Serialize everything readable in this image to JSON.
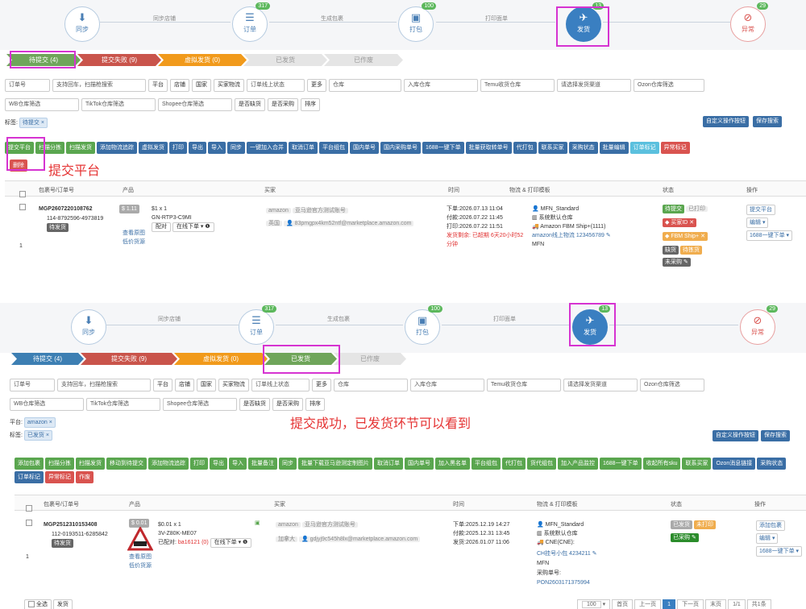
{
  "top": {
    "steps": [
      {
        "label": "同步"
      },
      {
        "label": "订单",
        "badge": "317"
      },
      {
        "label": "打包",
        "badge": "100"
      },
      {
        "label": "发货",
        "badge": "13"
      },
      {
        "label": "异常",
        "badge": "29"
      }
    ],
    "connectors": [
      "同步店铺",
      "生成包裹",
      "打印面单"
    ],
    "pipeline": [
      "待提交 (4)",
      "提交失败 (9)",
      "虚拟发货 (0)",
      "已发货",
      "已作废"
    ],
    "filters_row1": [
      "订单号",
      "支持回车，扫描枪搜索",
      "平台",
      "店铺",
      "国家",
      "买家物流",
      "订单线上状态",
      "更多",
      "仓库",
      "入库仓库",
      "Temu收货仓库",
      "请选择发货渠道",
      "Ozon仓库筛选"
    ],
    "filters_row2": [
      "WB仓库筛选",
      "TikTok仓库筛选",
      "Shopee仓库筛选",
      "是否缺货",
      "是否采购",
      "排序"
    ],
    "tag_label": "标签:",
    "tag_value": "待提交",
    "right_buttons": [
      "自定义操作按钮",
      "保存搜索"
    ],
    "actions": [
      "提交平台",
      "扫描分拣",
      "扫描发货",
      "添加物流追踪",
      "虚拟发货",
      "打印",
      "导出",
      "导入",
      "同步",
      "一键加入合并",
      "取消订单",
      "平台组包",
      "国内单号",
      "国内采购单号",
      "1688一键下单",
      "批量获取转单号",
      "代打包",
      "联系买家",
      "采购状态",
      "批量编辑",
      "订单标记",
      "异常标记",
      "删除"
    ],
    "annotation": "提交平台",
    "table_headers": [
      "包裹号/订单号",
      "产品",
      "买家",
      "时间",
      "物流 & 打印模板",
      "状态",
      "操作"
    ],
    "row": {
      "index": "1",
      "package_no": "MGP2607220108762",
      "order_no": "114-8792596-4973819",
      "order_status": "待发货",
      "price": "$ 1.11",
      "qty": "$1 x 1",
      "sku": "GN-RTP3-C9MI",
      "view_link": "查看原图",
      "low_price": "低价货源",
      "pair_btn": "配对",
      "online_order": "在线下单",
      "buyer_platform": "amazon",
      "buyer_shop": "亚马逊官方测试账号",
      "buyer_country": "英国",
      "buyer_email": "83pmgpx4km52ntf@marketplace.amazon.com",
      "time_order": "下单:2026.07.13 11:04",
      "time_pay": "付款:2026.07.22 11:45",
      "time_print": "打印:2026.07.22 11:51",
      "time_deadline": "发货剩余: 已超期 6天20小时52分钟",
      "log_method": "MFN_Standard",
      "log_warehouse": "系统默认仓库",
      "log_service": "Amazon FBM Ship+(1111)",
      "log_tracking": "amazon线上物流 123456789",
      "log_mfn": "MFN",
      "status_1": "待提交",
      "status_2": "已打印",
      "status_3": "买家ID",
      "status_4": "FBM Ship+",
      "status_5": "缺货",
      "status_6": "待拣货",
      "status_7": "未采购",
      "op_1": "提交平台",
      "op_2": "编辑",
      "op_3": "1688一键下单"
    }
  },
  "bottom": {
    "steps": [
      {
        "label": "同步"
      },
      {
        "label": "订单",
        "badge": "317"
      },
      {
        "label": "打包",
        "badge": "100"
      },
      {
        "label": "发货",
        "badge": "13"
      },
      {
        "label": "异常",
        "badge": "29"
      }
    ],
    "connectors": [
      "同步店铺",
      "生成包裹",
      "打印面单"
    ],
    "pipeline": [
      "待提交 (4)",
      "提交失败 (9)",
      "虚拟发货 (0)",
      "已发货",
      "已作废"
    ],
    "filters_row1": [
      "订单号",
      "支持回车，扫描枪搜索",
      "平台",
      "店铺",
      "国家",
      "买家物流",
      "订单线上状态",
      "更多",
      "仓库",
      "入库仓库",
      "Temu收货仓库",
      "请选择发货渠道",
      "Ozon仓库筛选"
    ],
    "filters_row2": [
      "WB仓库筛选",
      "TikTok仓库筛选",
      "Shopee仓库筛选",
      "是否缺货",
      "是否采购",
      "排序"
    ],
    "platform_label": "平台:",
    "platform_value": "amazon",
    "tag_label": "标签:",
    "tag_value": "已发货",
    "annotation": "提交成功，已发货环节可以看到",
    "right_buttons": [
      "自定义操作按钮",
      "保存搜索"
    ],
    "actions": [
      "添加包裹",
      "扫描分拣",
      "扫描发货",
      "移动到待提交",
      "添加物流追踪",
      "打印",
      "导出",
      "导入",
      "批量备注",
      "同步",
      "批量下载亚马逊测定制图片",
      "取消订单",
      "国内单号",
      "加入黑名单",
      "平台组包",
      "代打包",
      "货代组包",
      "加入产品监控",
      "1688一键下单",
      "收起所有sku",
      "联系买家",
      "Ozon消息链接",
      "采购状态",
      "订单标记",
      "异常标记",
      "作废"
    ],
    "table_headers": [
      "包裹号/订单号",
      "产品",
      "买家",
      "时间",
      "物流 & 打印模板",
      "状态",
      "操作"
    ],
    "row": {
      "index": "1",
      "package_no": "MGP2512310153408",
      "order_no": "112-0193511-6285842",
      "order_status": "待发货",
      "price": "$ 0.01",
      "qty": "$0.01 x 1",
      "sku": "3V-Z80K-ME07",
      "view_link": "查看原图",
      "low_price": "低价货源",
      "paired": "已配对:",
      "paired_id": "ba16121 (0)",
      "online_order": "在线下单",
      "buyer_platform": "amazon",
      "buyer_shop": "亚马逊官方测试账号",
      "buyer_country": "加拿大",
      "buyer_email": "gdjyj9c545h8lx@marketplace.amazon.com",
      "time_order": "下单:2025.12.19 14:27",
      "time_pay": "付款:2025.12.31 13:45",
      "time_ship": "发货:2026.01.07 11:06",
      "log_method": "MFN_Standard",
      "log_warehouse": "系统默认仓库",
      "log_service": "CNE(CNE):",
      "log_tracking": "CH挂号小包 4234211",
      "log_mfn": "MFN",
      "log_purchase": "采购单号:",
      "log_purchase_no": "PON2603171375994",
      "status_1": "已发货",
      "status_2": "未打印",
      "status_3": "已采购",
      "op_1": "添加包裹",
      "op_2": "编辑",
      "op_3": "1688一键下单"
    },
    "footer": {
      "select_all": "全选",
      "ship": "发货",
      "page_size": "100",
      "pages": [
        "首页",
        "上一页",
        "1",
        "下一页",
        "末页",
        "1/1",
        "共1条"
      ]
    }
  }
}
